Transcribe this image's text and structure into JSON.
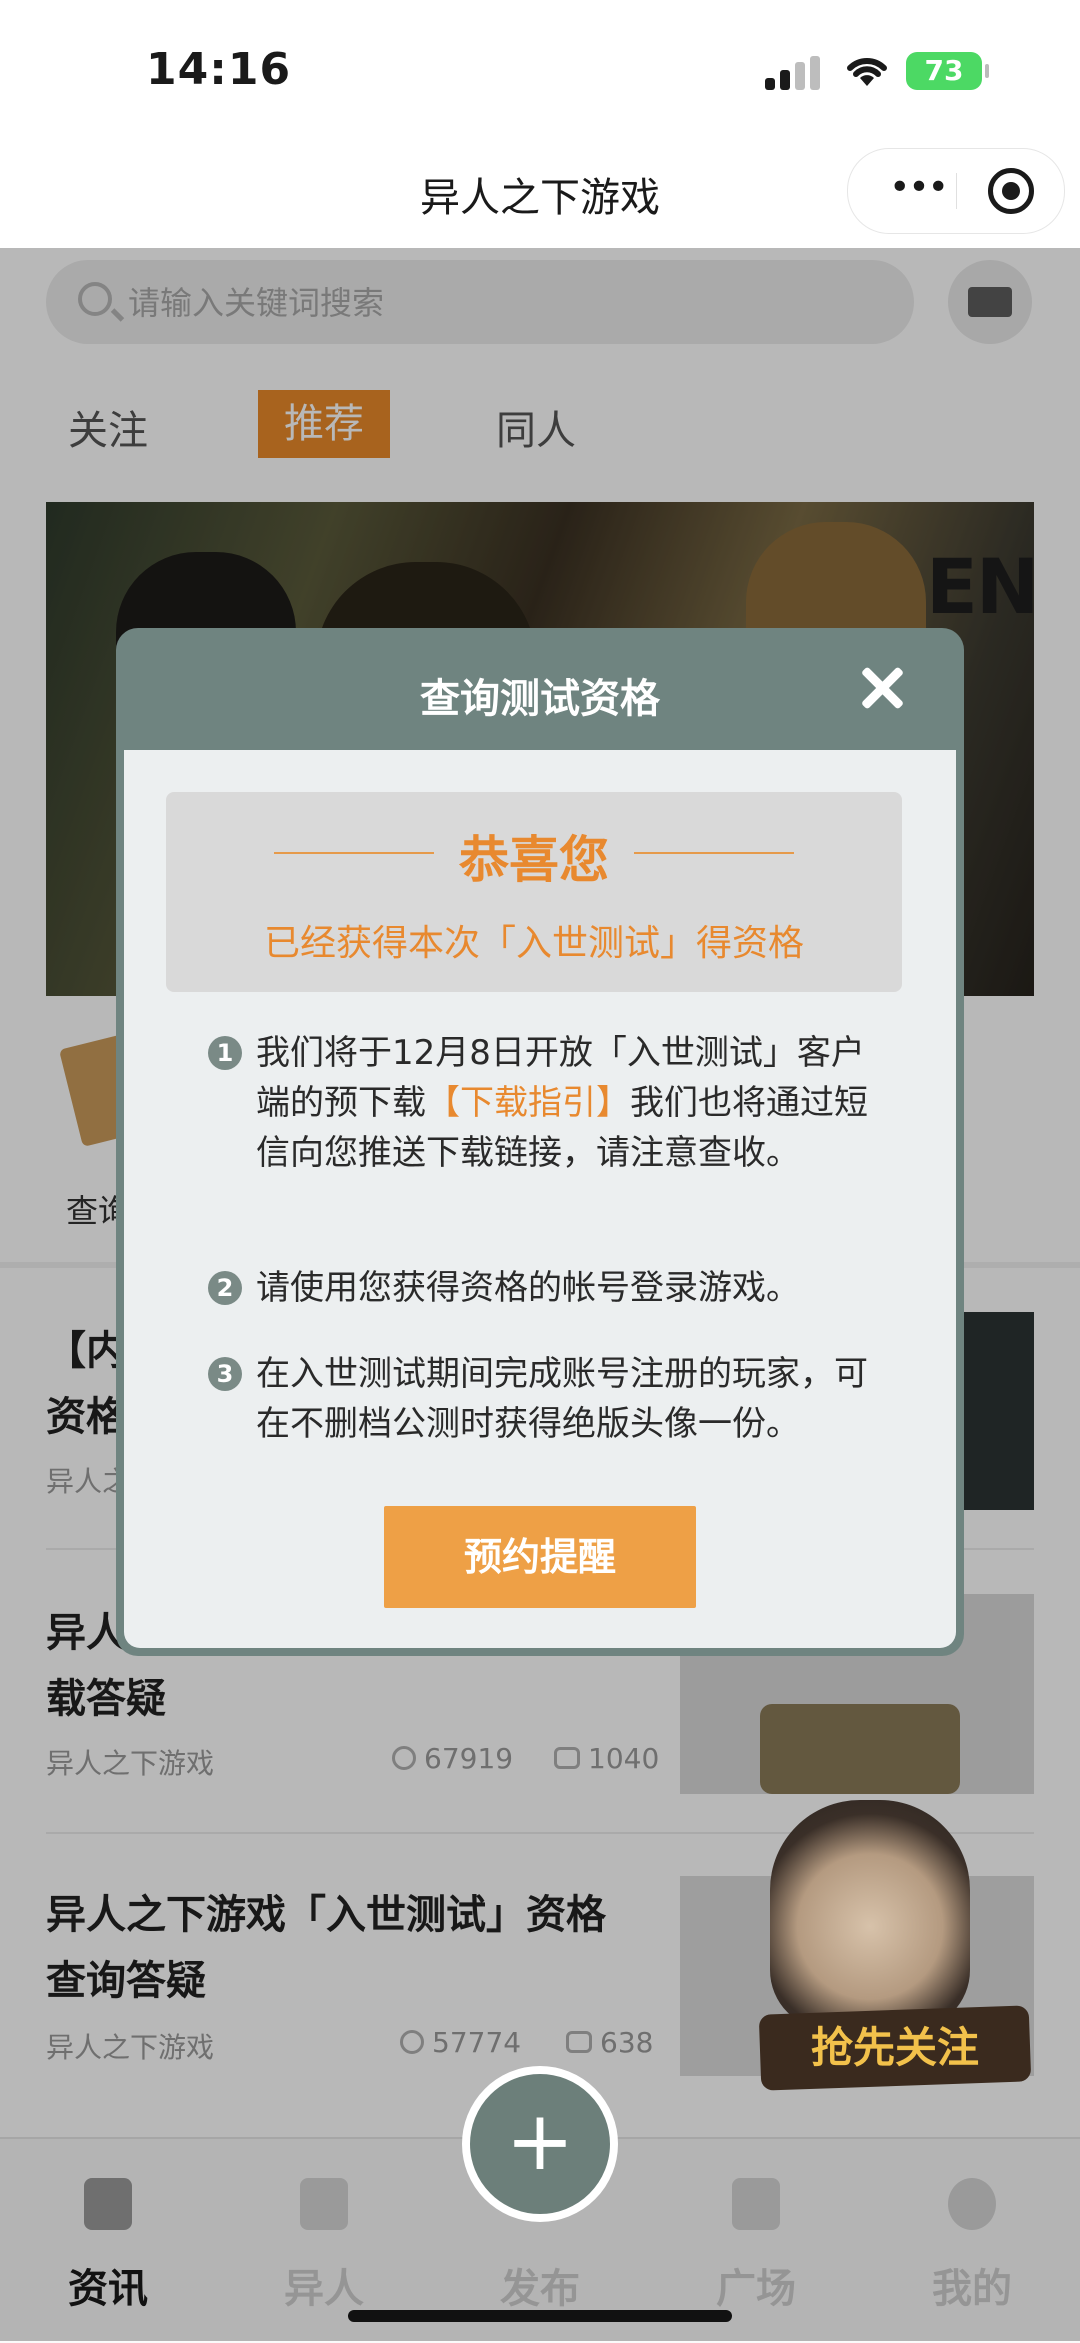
{
  "status_bar": {
    "time": "14:16",
    "battery": "73"
  },
  "header": {
    "title": "异人之下游戏"
  },
  "search": {
    "placeholder": "请输入关键词搜索"
  },
  "tabs": {
    "follow": "关注",
    "recommend": "推荐",
    "fan": "同人"
  },
  "banner": {
    "sign_text": "ENDT"
  },
  "shortcut": {
    "label": "查询"
  },
  "feed": [
    {
      "title_line1": "【内",
      "title_line2": "资格",
      "author": "异人之"
    },
    {
      "title_line1": "异人",
      "title_line2": "载答疑",
      "author": "异人之下游戏",
      "views": "67919",
      "comments": "1040"
    },
    {
      "title_line1": "异人之下游戏「入世测试」资格",
      "title_line2": "查询答疑",
      "author": "异人之下游戏",
      "views": "57774",
      "comments": "638"
    }
  ],
  "float_promo": {
    "label": "抢先关注"
  },
  "tabbar": {
    "news": "资讯",
    "yiren": "异人",
    "publish": "发布",
    "square": "广场",
    "mine": "我的"
  },
  "modal": {
    "title": "查询测试资格",
    "congrats_heading": "恭喜您",
    "congrats_sub": "已经获得本次「入世测试」得资格",
    "steps": [
      {
        "num": "1",
        "before": "我们将于12月8日开放「入世测试」客户端的预下载",
        "link": "【下载指引】",
        "after": "我们也将通过短信向您推送下载链接，请注意查收。"
      },
      {
        "num": "2",
        "text": "请使用您获得资格的帐号登录游戏。"
      },
      {
        "num": "3",
        "text": "在入世测试期间完成账号注册的玩家，可在不删档公测时获得绝版头像一份。"
      }
    ],
    "button": "预约提醒"
  },
  "colors": {
    "accent": "#e8892f",
    "modal_header": "#6f8480",
    "tab_active": "#e98a2a"
  }
}
